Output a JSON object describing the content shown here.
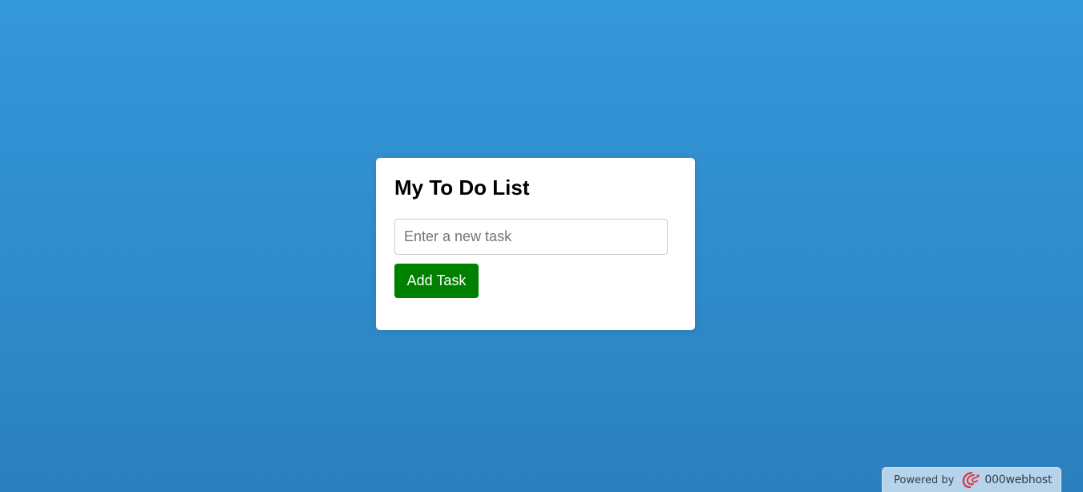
{
  "todo": {
    "title": "My To Do List",
    "input": {
      "placeholder": "Enter a new task",
      "value": ""
    },
    "add_button_label": "Add Task",
    "tasks": []
  },
  "footer_badge": {
    "powered_by": "Powered by",
    "brand": "000webhost",
    "logo_icon": "000webhost-logo-icon"
  },
  "colors": {
    "background_top": "#3498db",
    "background_bottom": "#2b80bd",
    "card": "#ffffff",
    "add_button": "#008000",
    "logo": "#e0303a"
  }
}
